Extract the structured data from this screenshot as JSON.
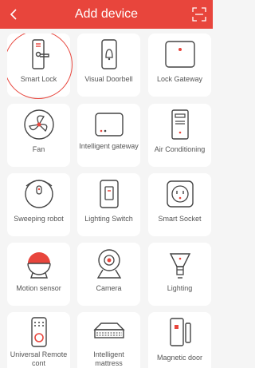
{
  "header": {
    "title": "Add device",
    "background": "#e8453c",
    "back_icon": "chevron-left-icon",
    "scan_icon": "scan-icon"
  },
  "devices": [
    {
      "label": "Smart Lock",
      "icon": "smart-lock-icon",
      "selected": true
    },
    {
      "label": "Visual Doorbell",
      "icon": "doorbell-icon"
    },
    {
      "label": "Lock Gateway",
      "icon": "lock-gateway-icon"
    },
    {
      "label": "Fan",
      "icon": "fan-icon"
    },
    {
      "label": "Intelligent gateway",
      "icon": "gateway-icon"
    },
    {
      "label": "Air Conditioning",
      "icon": "air-conditioner-icon"
    },
    {
      "label": "Sweeping robot",
      "icon": "robot-vacuum-icon"
    },
    {
      "label": "Lighting Switch",
      "icon": "light-switch-icon"
    },
    {
      "label": "Smart Socket",
      "icon": "socket-icon"
    },
    {
      "label": "Motion sensor",
      "icon": "motion-sensor-icon"
    },
    {
      "label": "Camera",
      "icon": "camera-icon"
    },
    {
      "label": "Lighting",
      "icon": "bulb-icon"
    },
    {
      "label": "Universal Remote cont",
      "icon": "remote-icon"
    },
    {
      "label": "Intelligent mattress",
      "icon": "mattress-icon"
    },
    {
      "label": "Magnetic door",
      "icon": "door-sensor-icon"
    }
  ],
  "accent": "#e8453c"
}
